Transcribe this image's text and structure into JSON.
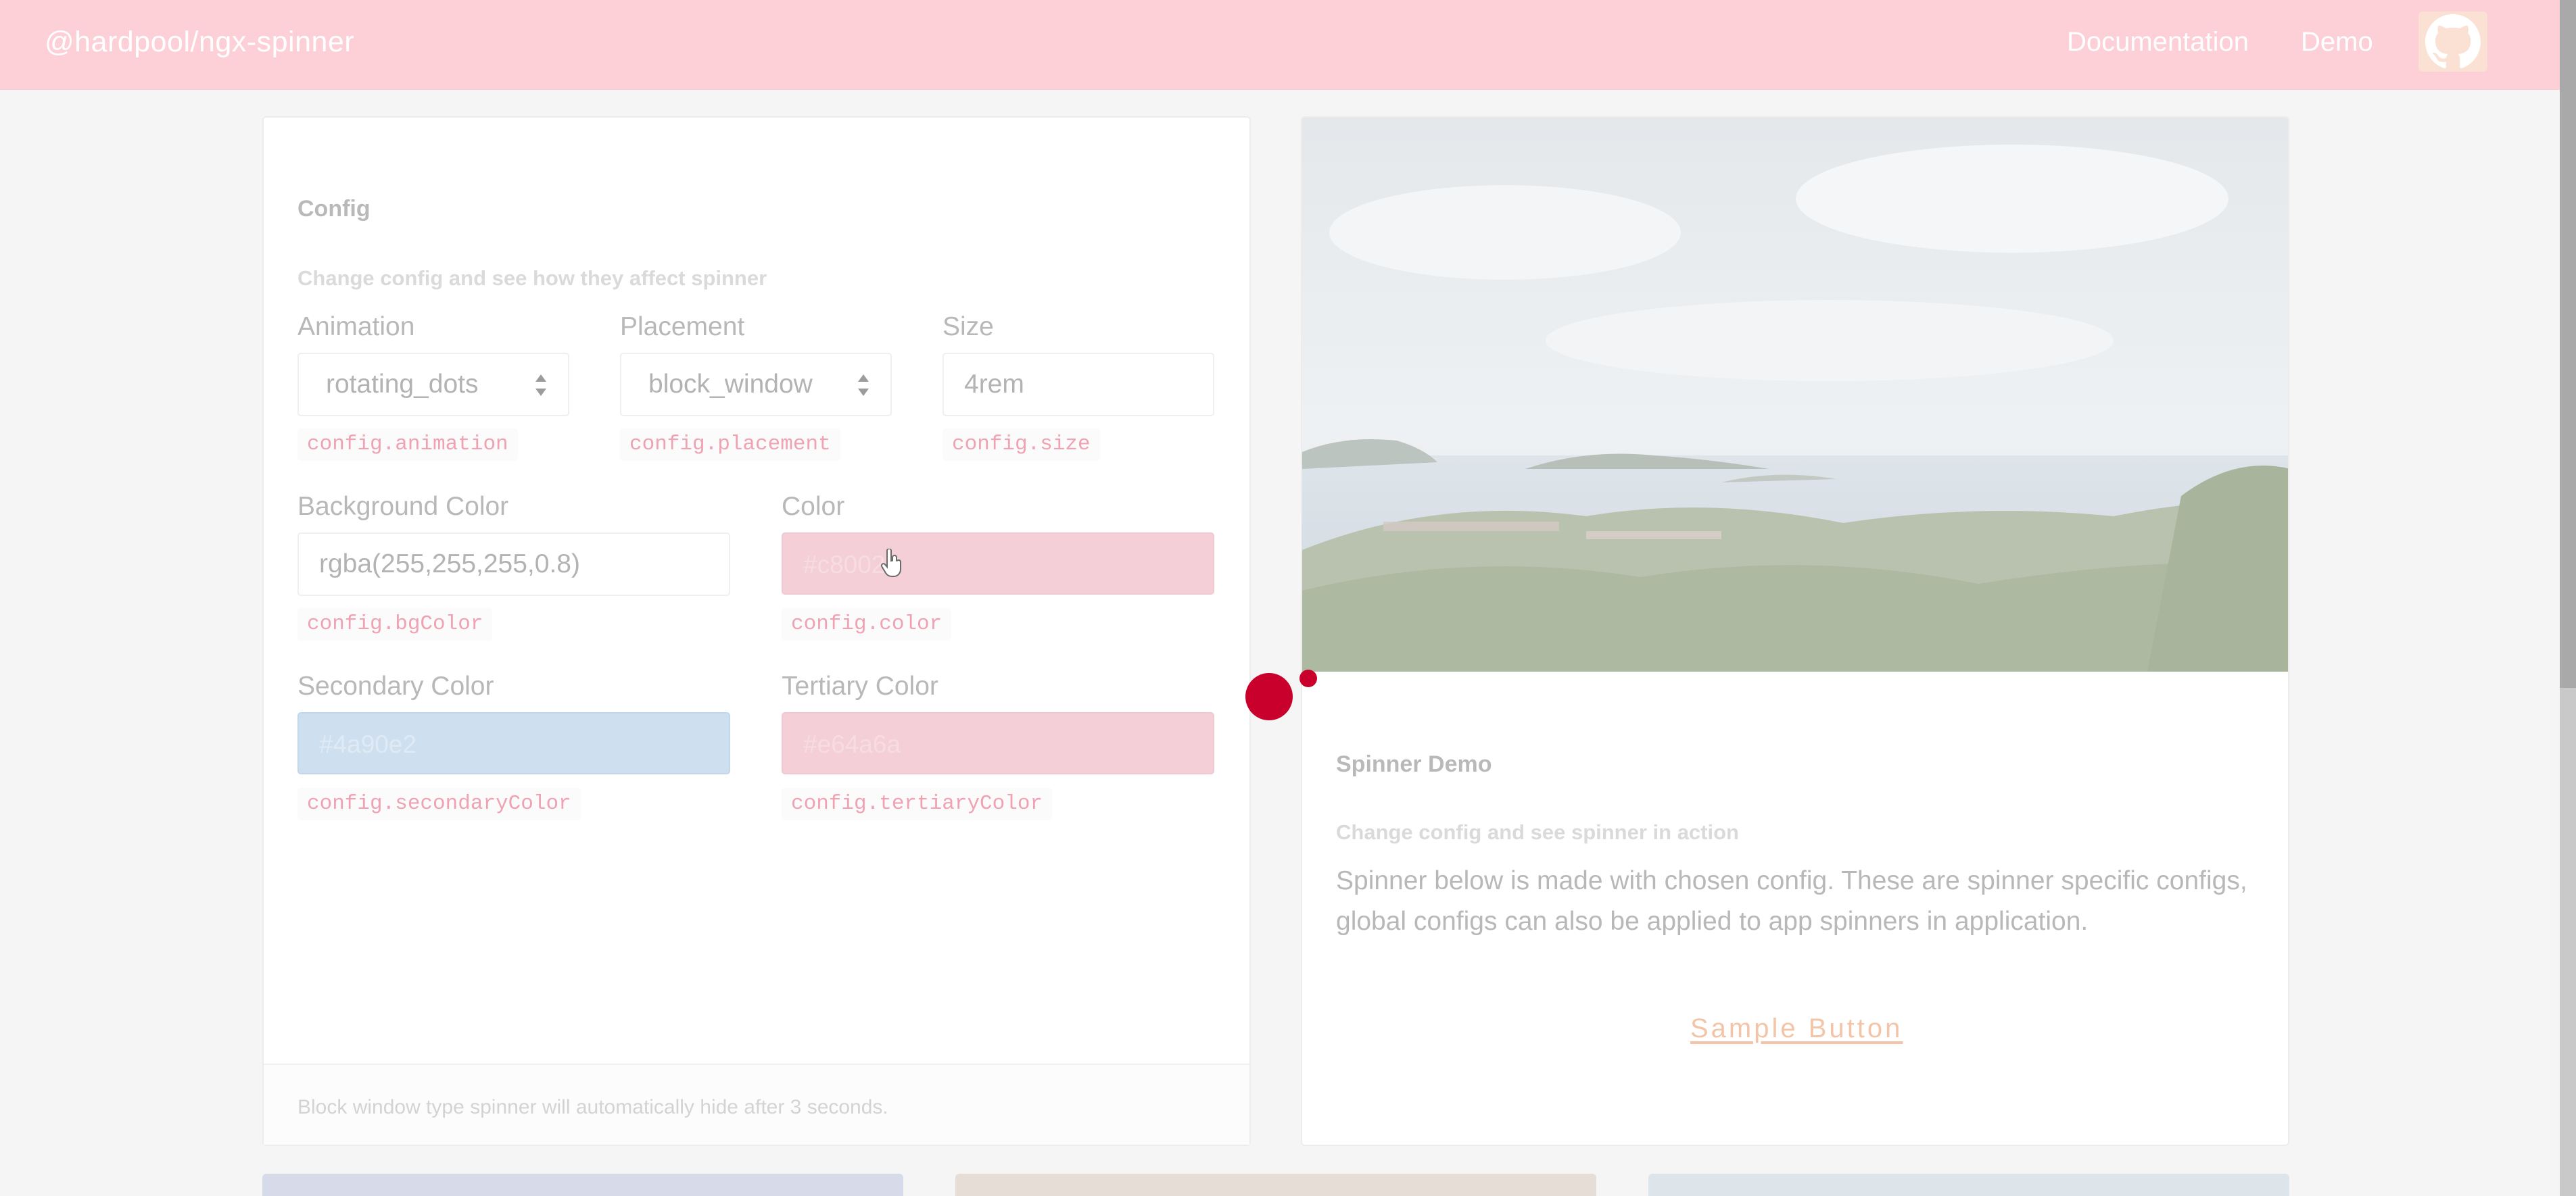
{
  "navbar": {
    "brand": "@hardpool/ngx-spinner",
    "links": [
      "Documentation",
      "Demo"
    ],
    "github_icon": "github-icon",
    "bg_color": "#fcd0d6"
  },
  "config_card": {
    "title": "Config",
    "subtitle": "Change config and see how they affect spinner",
    "animation": {
      "label": "Animation",
      "value": "rotating_dots",
      "code": "config.animation"
    },
    "placement": {
      "label": "Placement",
      "value": "block_window",
      "code": "config.placement"
    },
    "size": {
      "label": "Size",
      "value": "4rem",
      "code": "config.size"
    },
    "bg_color": {
      "label": "Background Color",
      "value": "rgba(255,255,255,0.8)",
      "code": "config.bgColor"
    },
    "color": {
      "label": "Color",
      "value": "#c8002b",
      "code": "config.color"
    },
    "secondary_color": {
      "label": "Secondary Color",
      "value": "#4a90e2",
      "code": "config.secondaryColor"
    },
    "tertiary_color": {
      "label": "Tertiary Color",
      "value": "#e64a6a",
      "code": "config.tertiaryColor"
    },
    "footer": "Block window type spinner will automatically hide after 3 seconds."
  },
  "demo_card": {
    "title": "Spinner Demo",
    "subtitle": "Change config and see spinner in action",
    "description": "Spinner below is made with chosen config. These are spinner specific configs, global configs can also be applied to app spinners in application.",
    "button": "Sample Button"
  },
  "spinner": {
    "color": "#c8002b"
  }
}
